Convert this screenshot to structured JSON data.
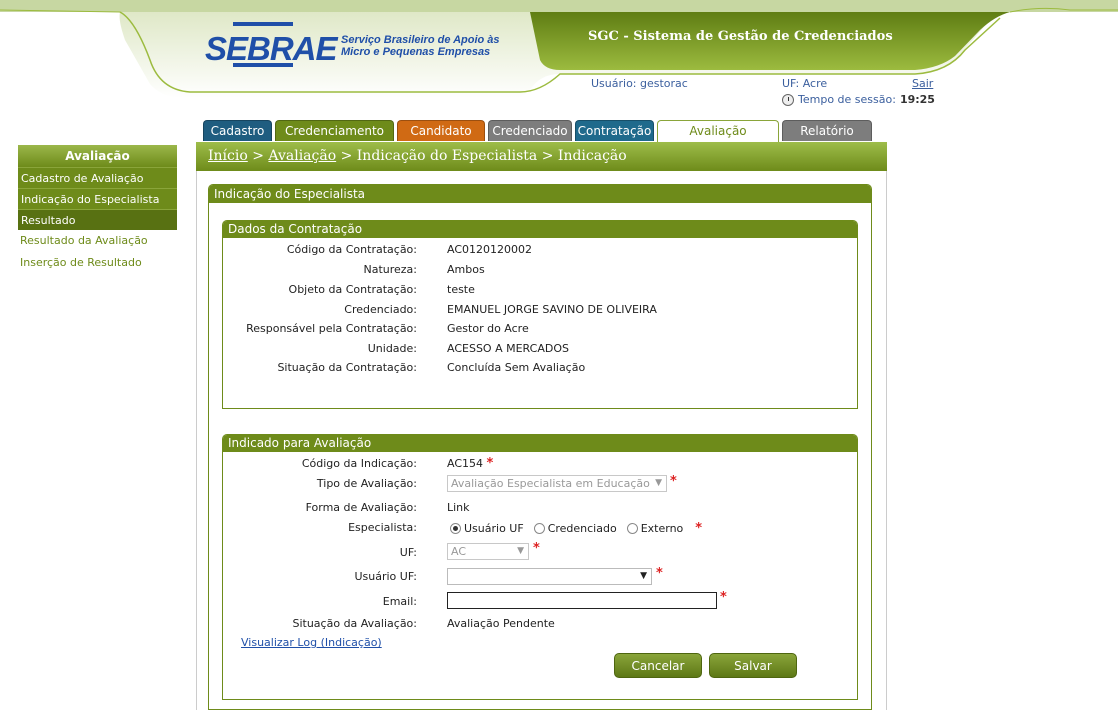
{
  "header": {
    "logo_word": "SEBRAE",
    "logo_tagline_1": "Serviço Brasileiro de Apoio às",
    "logo_tagline_2": "Micro e Pequenas Empresas",
    "system_title": "SGC - Sistema de Gestão de Credenciados",
    "user_label": "Usuário: gestorac",
    "uf_label": "UF: Acre",
    "logout": "Sair",
    "session_label": "Tempo de sessão:",
    "session_time": "19:25"
  },
  "tabs": [
    {
      "label": "Cadastro",
      "color": "#1f5d80"
    },
    {
      "label": "Credenciamento",
      "color": "#6e8b1a"
    },
    {
      "label": "Candidato",
      "color": "#d06a14"
    },
    {
      "label": "Credenciado",
      "color": "#7d7d7d"
    },
    {
      "label": "Contratação",
      "color": "#1f6a8c"
    },
    {
      "label": "Avaliação",
      "color": "#6e8b1a",
      "active": true
    },
    {
      "label": "Relatório",
      "color": "#7d7d7d"
    }
  ],
  "sidebar": {
    "title": "Avaliação",
    "items": [
      "Cadastro de Avaliação",
      "Indicação do Especialista",
      "Resultado"
    ],
    "subitems": [
      "Resultado da Avaliação",
      "Inserção de Resultado"
    ]
  },
  "breadcrumb": {
    "home": "Início",
    "sep1": " > ",
    "section": "Avaliação",
    "rest": " > Indicação do Especialista > Indicação"
  },
  "panel_title": "Indicação do Especialista",
  "dados": {
    "title": "Dados da Contratação",
    "rows": [
      {
        "label": "Código da Contratação:",
        "value": "AC0120120002"
      },
      {
        "label": "Natureza:",
        "value": "Ambos"
      },
      {
        "label": "Objeto da Contratação:",
        "value": "teste"
      },
      {
        "label": "Credenciado:",
        "value": "EMANUEL JORGE SAVINO DE OLIVEIRA"
      },
      {
        "label": "Responsável pela Contratação:",
        "value": "Gestor do Acre"
      },
      {
        "label": "Unidade:",
        "value": "ACESSO A MERCADOS"
      },
      {
        "label": "Situação da Contratação:",
        "value": "Concluída Sem Avaliação"
      }
    ]
  },
  "indicado": {
    "title": "Indicado para Avaliação",
    "codigo_label": "Código da Indicação:",
    "codigo_value": "AC154",
    "tipo_label": "Tipo de Avaliação:",
    "tipo_value": "Avaliação Especialista em Educação",
    "forma_label": "Forma de Avaliação:",
    "forma_value": "Link",
    "especialista_label": "Especialista:",
    "especialista_options": [
      "Usuário UF",
      "Credenciado",
      "Externo"
    ],
    "especialista_selected": "Usuário UF",
    "uf_label": "UF:",
    "uf_value": "AC",
    "usuario_label": "Usuário UF:",
    "usuario_value": "",
    "email_label": "Email:",
    "email_value": "",
    "situacao_label": "Situação da Avaliação:",
    "situacao_value": "Avaliação Pendente",
    "required_mark": "*"
  },
  "log_link": "Visualizar Log (Indicação)",
  "buttons": {
    "cancel": "Cancelar",
    "save": "Salvar"
  }
}
